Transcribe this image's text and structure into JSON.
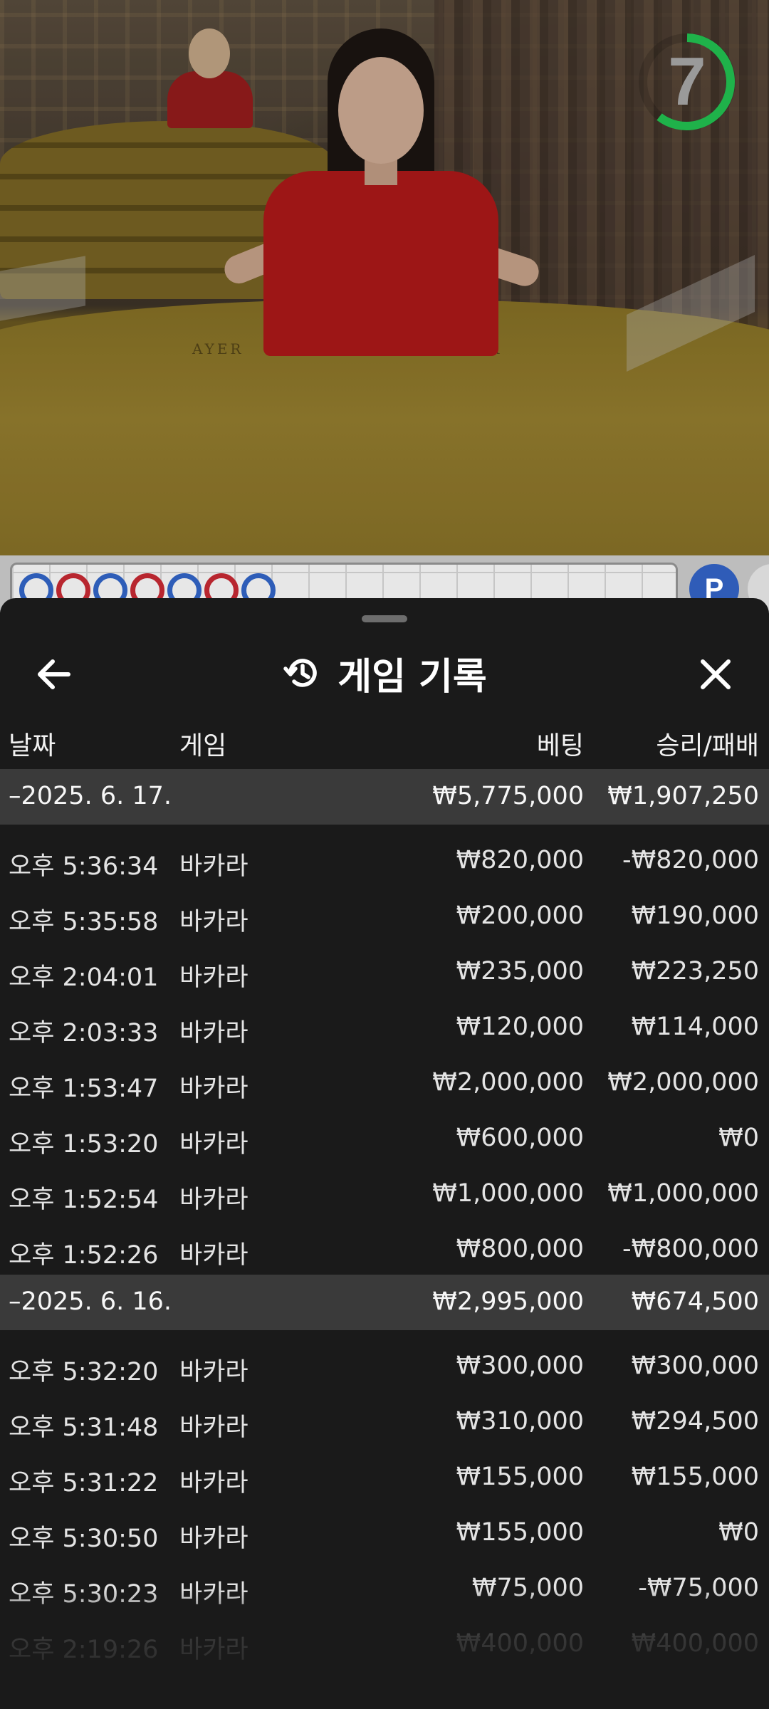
{
  "timer": {
    "value": "7",
    "ring_color": "#1fb24a"
  },
  "roadmap": {
    "results": [
      "P",
      "B",
      "P",
      "B",
      "P",
      "B",
      "P"
    ],
    "player_color": "#2e5db8",
    "banker_color": "#b8262f",
    "button_label": "P"
  },
  "header": {
    "title": "게임 기록",
    "back_icon": "arrow-left-icon",
    "history_icon": "history-icon",
    "close_icon": "close-icon"
  },
  "columns": {
    "date": "날짜",
    "game": "게임",
    "bet": "베팅",
    "win_loss": "승리/패배"
  },
  "groups": [
    {
      "date": "–2025. 6. 17.",
      "total_bet": "₩5,775,000",
      "total_win": "₩1,907,250",
      "rows": [
        {
          "time": "오후 5:36:34",
          "game": "바카라",
          "bet": "₩820,000",
          "win": "-₩820,000"
        },
        {
          "time": "오후 5:35:58",
          "game": "바카라",
          "bet": "₩200,000",
          "win": "₩190,000"
        },
        {
          "time": "오후 2:04:01",
          "game": "바카라",
          "bet": "₩235,000",
          "win": "₩223,250"
        },
        {
          "time": "오후 2:03:33",
          "game": "바카라",
          "bet": "₩120,000",
          "win": "₩114,000"
        },
        {
          "time": "오후 1:53:47",
          "game": "바카라",
          "bet": "₩2,000,000",
          "win": "₩2,000,000"
        },
        {
          "time": "오후 1:53:20",
          "game": "바카라",
          "bet": "₩600,000",
          "win": "₩0"
        },
        {
          "time": "오후 1:52:54",
          "game": "바카라",
          "bet": "₩1,000,000",
          "win": "₩1,000,000"
        },
        {
          "time": "오후 1:52:26",
          "game": "바카라",
          "bet": "₩800,000",
          "win": "-₩800,000"
        }
      ]
    },
    {
      "date": "–2025. 6. 16.",
      "total_bet": "₩2,995,000",
      "total_win": "₩674,500",
      "rows": [
        {
          "time": "오후 5:32:20",
          "game": "바카라",
          "bet": "₩300,000",
          "win": "₩300,000"
        },
        {
          "time": "오후 5:31:48",
          "game": "바카라",
          "bet": "₩310,000",
          "win": "₩294,500"
        },
        {
          "time": "오후 5:31:22",
          "game": "바카라",
          "bet": "₩155,000",
          "win": "₩155,000"
        },
        {
          "time": "오후 5:30:50",
          "game": "바카라",
          "bet": "₩155,000",
          "win": "₩0"
        },
        {
          "time": "오후 5:30:23",
          "game": "바카라",
          "bet": "₩75,000",
          "win": "-₩75,000"
        },
        {
          "time": "오후 2:19:26",
          "game": "바카라",
          "bet": "₩400,000",
          "win": "₩400,000"
        }
      ]
    }
  ]
}
